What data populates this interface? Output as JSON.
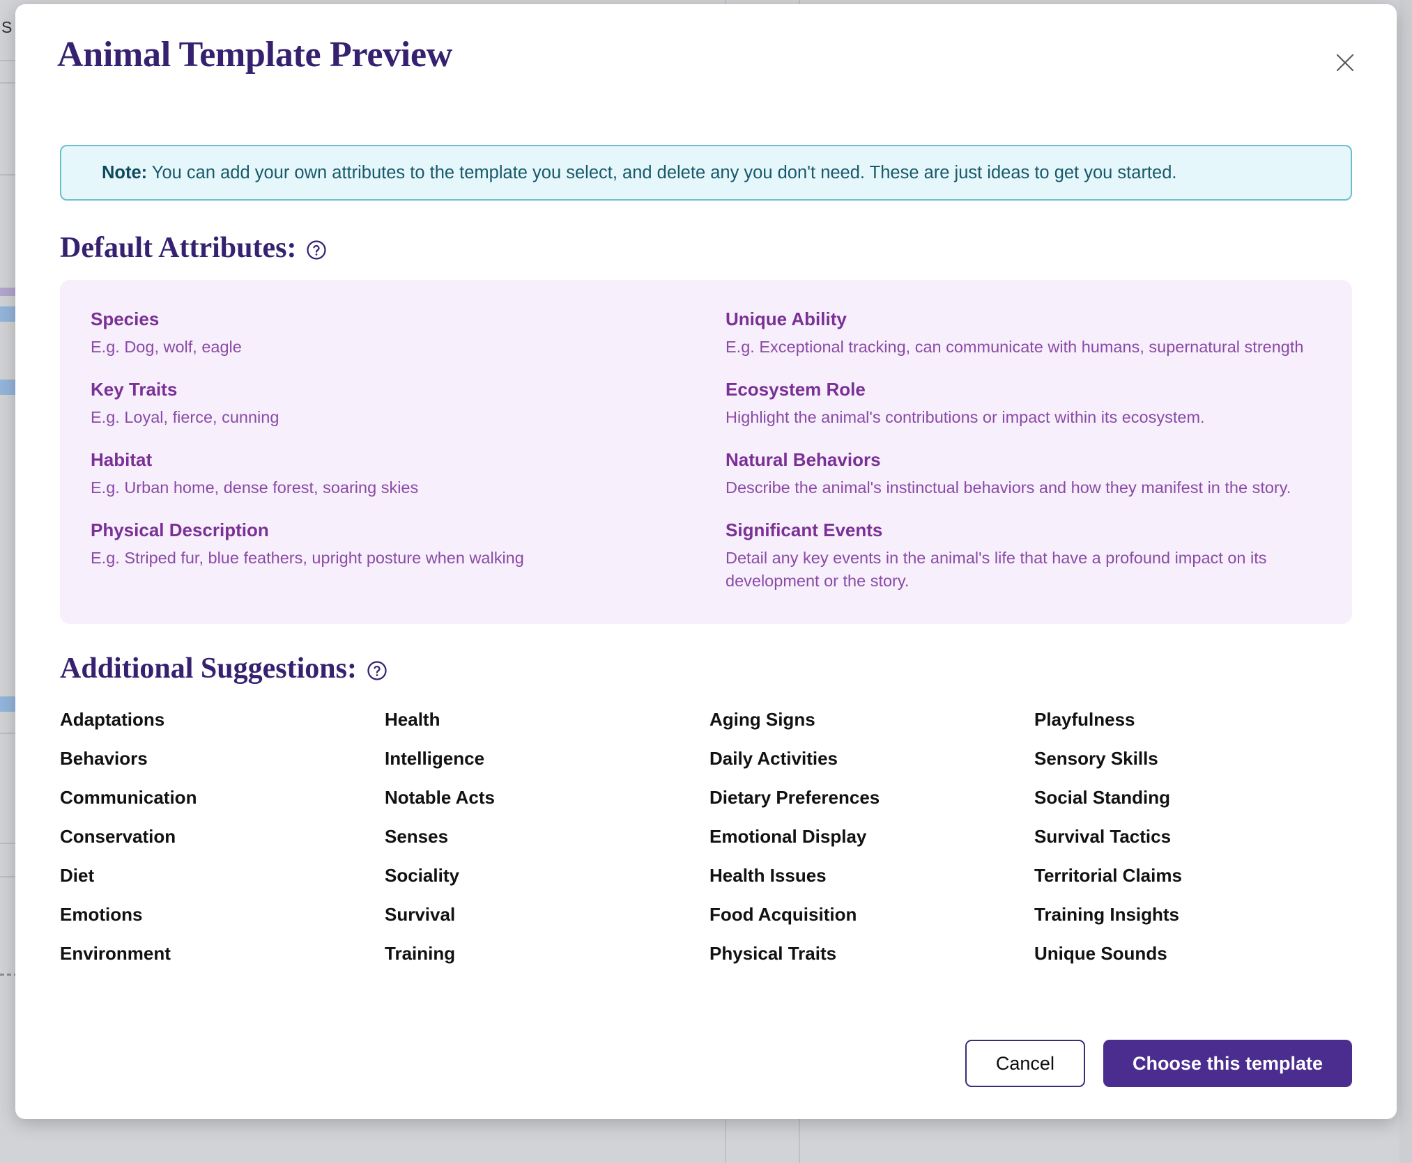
{
  "modal": {
    "title": "Animal Template Preview",
    "close_icon": "close-icon",
    "note": {
      "label": "Note:",
      "text": " You can add your own attributes to the template you select, and delete any you don't need. These are just ideas to get you started."
    },
    "default_attributes_heading": "Default Attributes:",
    "additional_suggestions_heading": "Additional Suggestions:",
    "help_icon": "help-circle-icon",
    "default_attributes": {
      "left": [
        {
          "name": "Species",
          "desc": "E.g. Dog, wolf, eagle"
        },
        {
          "name": "Key Traits",
          "desc": "E.g. Loyal, fierce, cunning"
        },
        {
          "name": "Habitat",
          "desc": "E.g. Urban home, dense forest, soaring skies"
        },
        {
          "name": "Physical Description",
          "desc": "E.g. Striped fur, blue feathers, upright posture when walking"
        }
      ],
      "right": [
        {
          "name": "Unique Ability",
          "desc": "E.g. Exceptional tracking, can communicate with humans, supernatural strength"
        },
        {
          "name": "Ecosystem Role",
          "desc": "Highlight the animal's contributions or impact within its ecosystem."
        },
        {
          "name": "Natural Behaviors",
          "desc": "Describe the animal's instinctual behaviors and how they manifest in the story."
        },
        {
          "name": "Significant Events",
          "desc": "Detail any key events in the animal's life that have a profound impact on its development or the story."
        }
      ]
    },
    "additional_suggestions": {
      "col1": [
        "Adaptations",
        "Behaviors",
        "Communication",
        "Conservation",
        "Diet",
        "Emotions",
        "Environment"
      ],
      "col2": [
        "Health",
        "Intelligence",
        "Notable Acts",
        "Senses",
        "Sociality",
        "Survival",
        "Training"
      ],
      "col3": [
        "Aging Signs",
        "Daily Activities",
        "Dietary Preferences",
        "Emotional Display",
        "Health Issues",
        "Food Acquisition",
        "Physical Traits"
      ],
      "col4": [
        "Playfulness",
        "Sensory Skills",
        "Social Standing",
        "Survival Tactics",
        "Territorial Claims",
        "Training Insights",
        "Unique Sounds"
      ]
    },
    "footer": {
      "cancel_label": "Cancel",
      "choose_label": "Choose this template"
    }
  },
  "background": {
    "side_text": "S"
  },
  "colors": {
    "title_purple": "#362170",
    "attribute_purple": "#7a3095",
    "attribute_desc_purple": "#8a4aa6",
    "panel_bg": "#f7f0fc",
    "note_bg": "#e6f7fb",
    "note_border": "#6cbfcf",
    "note_text": "#17596b",
    "primary_button": "#4a2d8f",
    "backdrop": "#d2d3d6"
  }
}
